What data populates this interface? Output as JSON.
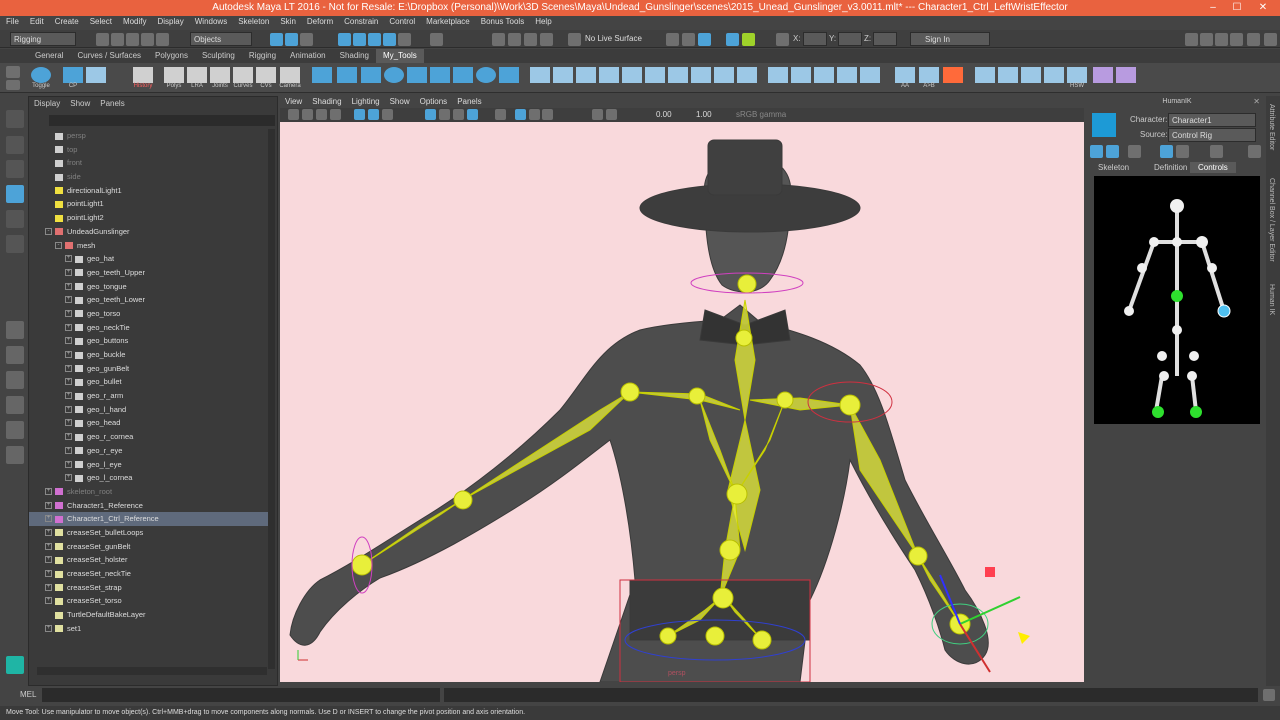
{
  "window": {
    "title": "Autodesk Maya LT 2016 - Not for Resale: E:\\Dropbox (Personal)\\Work\\3D Scenes\\Maya\\Undead_Gunslinger\\scenes\\2015_Unead_Gunslinger_v3.0011.mlt*  ---  Character1_Ctrl_LeftWristEffector",
    "min": "–",
    "max": "☐",
    "close": "✕"
  },
  "menubar": [
    "File",
    "Edit",
    "Create",
    "Select",
    "Modify",
    "Display",
    "Windows",
    "Skeleton",
    "Skin",
    "Deform",
    "Constrain",
    "Control",
    "Marketplace",
    "Bonus Tools",
    "Help"
  ],
  "status": {
    "menuset": "Rigging",
    "selmode": "Objects",
    "live_surface": "No Live Surface",
    "x_label": "X:",
    "y_label": "Y:",
    "z_label": "Z:",
    "signin": "Sign In"
  },
  "shelf_tabs": [
    "General",
    "Curves / Surfaces",
    "Polygons",
    "Sculpting",
    "Rigging",
    "Animation",
    "Shading",
    "My_Tools"
  ],
  "shelf_tabs_active": 7,
  "shelf_labels": [
    "Toggle",
    "CP",
    "History",
    "Polys",
    "LRA",
    "Joints",
    "Curves",
    "CVs",
    "Camera",
    "AA",
    "A>B",
    "HSW"
  ],
  "outliner": {
    "menu": [
      "Display",
      "Show",
      "Panels"
    ],
    "rows": [
      {
        "label": "persp",
        "indent": 1,
        "icon": "camera",
        "dim": true
      },
      {
        "label": "top",
        "indent": 1,
        "icon": "camera",
        "dim": true
      },
      {
        "label": "front",
        "indent": 1,
        "icon": "camera",
        "dim": true
      },
      {
        "label": "side",
        "indent": 1,
        "icon": "camera",
        "dim": true
      },
      {
        "label": "directionalLight1",
        "indent": 1,
        "icon": "light"
      },
      {
        "label": "pointLight1",
        "indent": 1,
        "icon": "light"
      },
      {
        "label": "pointLight2",
        "indent": 1,
        "icon": "light"
      },
      {
        "label": "UndeadGunslinger",
        "indent": 1,
        "icon": "group",
        "expander": "-"
      },
      {
        "label": "mesh",
        "indent": 2,
        "icon": "group",
        "expander": "-"
      },
      {
        "label": "geo_hat",
        "indent": 3,
        "icon": "mesh",
        "expander": "+"
      },
      {
        "label": "geo_teeth_Upper",
        "indent": 3,
        "icon": "mesh",
        "expander": "+"
      },
      {
        "label": "geo_tongue",
        "indent": 3,
        "icon": "mesh",
        "expander": "+"
      },
      {
        "label": "geo_teeth_Lower",
        "indent": 3,
        "icon": "mesh",
        "expander": "+"
      },
      {
        "label": "geo_torso",
        "indent": 3,
        "icon": "mesh",
        "expander": "+"
      },
      {
        "label": "geo_neckTie",
        "indent": 3,
        "icon": "mesh",
        "expander": "+"
      },
      {
        "label": "geo_buttons",
        "indent": 3,
        "icon": "mesh",
        "expander": "+"
      },
      {
        "label": "geo_buckle",
        "indent": 3,
        "icon": "mesh",
        "expander": "+"
      },
      {
        "label": "geo_gunBelt",
        "indent": 3,
        "icon": "mesh",
        "expander": "+"
      },
      {
        "label": "geo_bullet",
        "indent": 3,
        "icon": "mesh",
        "expander": "+"
      },
      {
        "label": "geo_r_arm",
        "indent": 3,
        "icon": "mesh",
        "expander": "+"
      },
      {
        "label": "geo_l_hand",
        "indent": 3,
        "icon": "mesh",
        "expander": "+"
      },
      {
        "label": "geo_head",
        "indent": 3,
        "icon": "mesh",
        "expander": "+"
      },
      {
        "label": "geo_r_cornea",
        "indent": 3,
        "icon": "mesh",
        "expander": "+"
      },
      {
        "label": "geo_r_eye",
        "indent": 3,
        "icon": "mesh",
        "expander": "+"
      },
      {
        "label": "geo_l_eye",
        "indent": 3,
        "icon": "mesh",
        "expander": "+"
      },
      {
        "label": "geo_l_cornea",
        "indent": 3,
        "icon": "mesh",
        "expander": "+"
      },
      {
        "label": "skeleton_root",
        "indent": 1,
        "icon": "joint",
        "expander": "+",
        "dim": true
      },
      {
        "label": "Character1_Reference",
        "indent": 1,
        "icon": "joint",
        "expander": "+"
      },
      {
        "label": "Character1_Ctrl_Reference",
        "indent": 1,
        "icon": "joint",
        "expander": "+",
        "selected": true
      },
      {
        "label": "creaseSet_bulletLoops",
        "indent": 1,
        "icon": "set",
        "expander": "+"
      },
      {
        "label": "creaseSet_gunBelt",
        "indent": 1,
        "icon": "set",
        "expander": "+"
      },
      {
        "label": "creaseSet_holster",
        "indent": 1,
        "icon": "set",
        "expander": "+"
      },
      {
        "label": "creaseSet_neckTie",
        "indent": 1,
        "icon": "set",
        "expander": "+"
      },
      {
        "label": "creaseSet_strap",
        "indent": 1,
        "icon": "set",
        "expander": "+"
      },
      {
        "label": "creaseSet_torso",
        "indent": 1,
        "icon": "set",
        "expander": "+"
      },
      {
        "label": "TurtleDefaultBakeLayer",
        "indent": 1,
        "icon": "set"
      },
      {
        "label": "set1",
        "indent": 1,
        "icon": "set",
        "expander": "+"
      }
    ]
  },
  "viewport": {
    "menu": [
      "View",
      "Shading",
      "Lighting",
      "Show",
      "Options",
      "Panels"
    ],
    "exposure": "0.00",
    "gamma": "1.00",
    "colorspace": "sRGB gamma",
    "camera_label": "persp"
  },
  "hik": {
    "title": "HumanIK",
    "character_label": "Character:",
    "character_value": "Character1",
    "source_label": "Source:",
    "source_value": "Control Rig",
    "tabs": [
      "Skeleton",
      "Definition",
      "Controls"
    ],
    "active_tab": 2
  },
  "side_tabs": [
    "Attribute Editor",
    "Channel Box / Layer Editor",
    "Human IK"
  ],
  "cmdline": {
    "label": "MEL"
  },
  "helpline": "Move Tool: Use manipulator to move object(s). Ctrl+MMB+drag to move components along normals. Use D or INSERT to change the pivot position and axis orientation.",
  "colors": {
    "titlebar": "#e9623f",
    "viewport_bg": "#f9d9dc",
    "joint": "#e8ef3a",
    "selected_blue": "#4da3d8"
  }
}
